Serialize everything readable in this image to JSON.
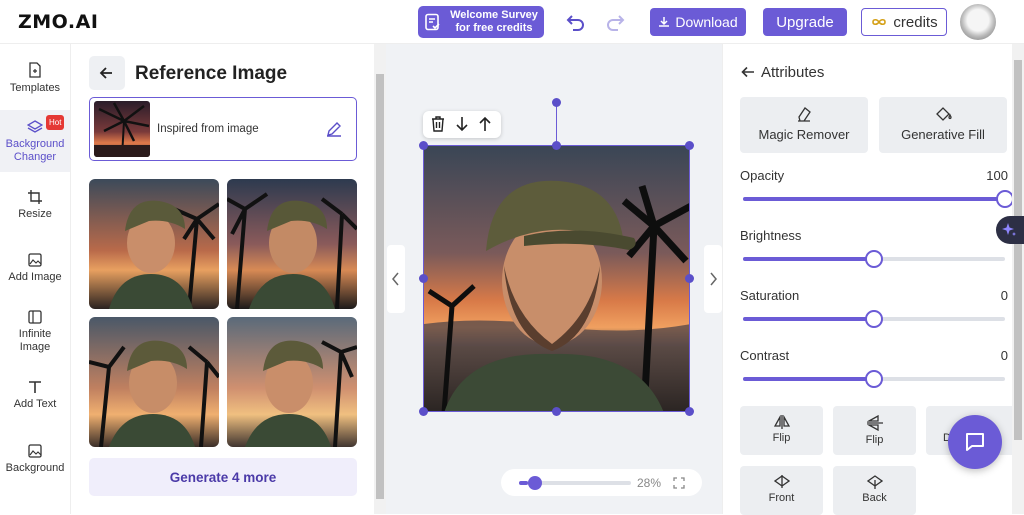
{
  "app": {
    "logo": "ZMO.AI"
  },
  "header": {
    "survey_line1": "Welcome Survey",
    "survey_line2": "for free credits",
    "download_label": "Download",
    "upgrade_label": "Upgrade",
    "credits_label": "credits",
    "credits_icon": "infinity-icon"
  },
  "toolbar": {
    "items": [
      {
        "label": "Templates",
        "icon": "template-icon"
      },
      {
        "label": "Background Changer",
        "icon": "layers-icon",
        "badge": "Hot"
      },
      {
        "label": "Resize",
        "icon": "crop-icon"
      },
      {
        "label": "Add Image",
        "icon": "image-icon"
      },
      {
        "label": "Infinite Image",
        "icon": "expand-icon"
      },
      {
        "label": "Add Text",
        "icon": "text-icon"
      },
      {
        "label": "Background",
        "icon": "background-icon"
      }
    ]
  },
  "reference": {
    "title": "Reference Image",
    "inspired_label": "Inspired from image",
    "generate_label": "Generate 4 more"
  },
  "canvas": {
    "zoom": "28%",
    "zoom_level": 0.08
  },
  "attributes": {
    "title": "Attributes",
    "magic_remover": "Magic Remover",
    "generative_fill": "Generative Fill",
    "sliders": [
      {
        "label": "Opacity",
        "value": "100",
        "level": 1.0
      },
      {
        "label": "Brightness",
        "value": "",
        "level": 0.5
      },
      {
        "label": "Saturation",
        "value": "0",
        "level": 0.5
      },
      {
        "label": "Contrast",
        "value": "0",
        "level": 0.5
      }
    ],
    "flip_h": "Flip",
    "flip_v": "Flip",
    "third_partial": "D",
    "front": "Front",
    "back": "Back"
  },
  "colors": {
    "accent": "#6b5bd6"
  }
}
